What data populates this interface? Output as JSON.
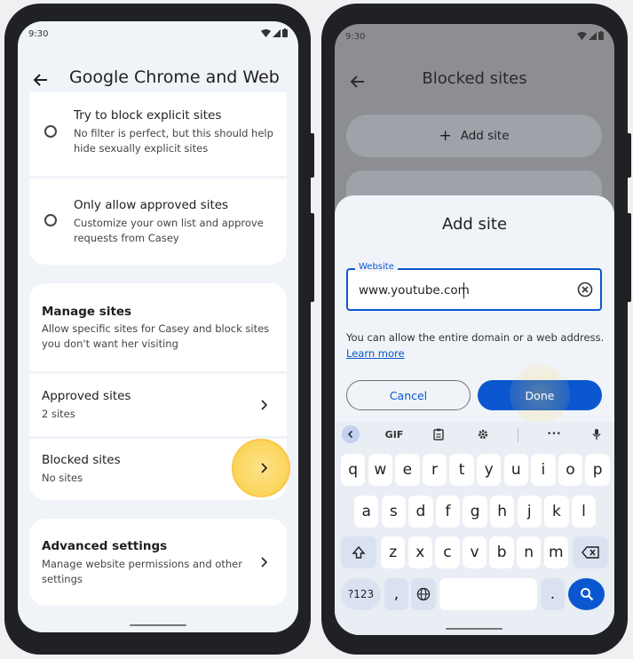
{
  "status": {
    "time": "9:30"
  },
  "left": {
    "title": "Google Chrome and Web",
    "options": [
      {
        "title": "Try to block explicit sites",
        "sub1": "No filter is perfect, but this should help",
        "sub2": "hide sexually explicit sites"
      },
      {
        "title": "Only allow approved sites",
        "sub1": "Customize your own list and approve",
        "sub2": "requests from Casey"
      }
    ],
    "manage": {
      "title": "Manage sites",
      "sub1": "Allow specific sites for Casey and block sites",
      "sub2": "you don't want her visiting"
    },
    "approved": {
      "title": "Approved sites",
      "sub": "2 sites"
    },
    "blocked": {
      "title": "Blocked sites",
      "sub": "No sites"
    },
    "advanced": {
      "title": "Advanced settings",
      "sub1": "Manage website permissions and other",
      "sub2": "settings"
    }
  },
  "right": {
    "title": "Blocked sites",
    "add_site_button": "Add site",
    "dialog": {
      "title": "Add site",
      "field_label": "Website",
      "field_value": "www.youtube.com",
      "help_text": "You can allow the entire domain or a web address.",
      "learn_more": "Learn more",
      "cancel": "Cancel",
      "done": "Done"
    },
    "keyboard": {
      "toolbar": {
        "gif": "GIF",
        "more": "•••"
      },
      "row1": [
        "q",
        "w",
        "e",
        "r",
        "t",
        "y",
        "u",
        "i",
        "o",
        "p"
      ],
      "row2": [
        "a",
        "s",
        "d",
        "f",
        "g",
        "h",
        "j",
        "k",
        "l"
      ],
      "row3": [
        "z",
        "x",
        "c",
        "v",
        "b",
        "n",
        "m"
      ],
      "symbols": "?123",
      "comma": ",",
      "period": "."
    }
  },
  "colors": {
    "accent": "#0b57d0",
    "highlight": "#fbd55a",
    "scrim": "#8c8e91"
  }
}
